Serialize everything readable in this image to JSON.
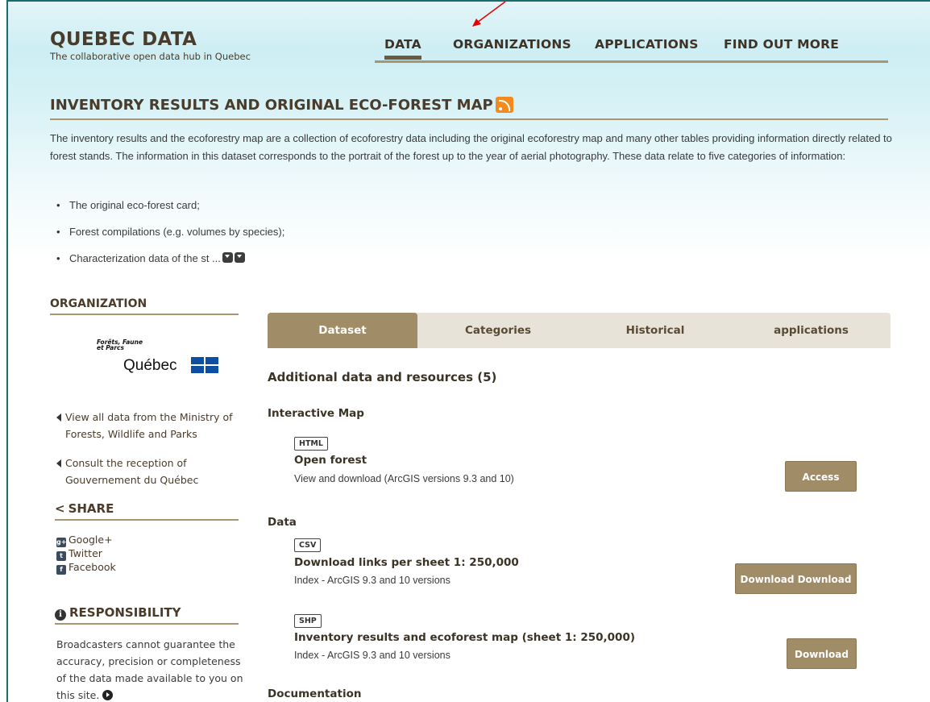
{
  "site": {
    "title": "QUEBEC DATA",
    "subtitle": "The collaborative open data hub in Quebec"
  },
  "nav": {
    "items": [
      {
        "label": "DATA",
        "active": true
      },
      {
        "label": "ORGANIZATIONS",
        "active": false
      },
      {
        "label": "APPLICATIONS",
        "active": false
      },
      {
        "label": "FIND OUT MORE",
        "active": false
      }
    ]
  },
  "dataset": {
    "title": "INVENTORY RESULTS AND ORIGINAL ECO-FOREST MAP",
    "description": "The inventory results and the ecoforestry map are a collection of ecoforestry data including the original ecoforestry map and many other tables providing information directly related to forest stands. The information in this dataset corresponds to the portrait of the forest up to the year of aerial photography. These data relate to five categories of information:",
    "bullets": [
      "The original eco-forest card;",
      "Forest compilations (e.g. volumes by species);",
      "Characterization data of the st ..."
    ]
  },
  "sidebar": {
    "organization_heading": "ORGANIZATION",
    "logo_line1": "Forêts, Faune",
    "logo_line2": "et Parcs",
    "logo_name": "Québec",
    "links": [
      "View all data from the Ministry of Forests, Wildlife and Parks",
      "Consult the reception of Gouvernement du Québec"
    ],
    "share_heading": "SHARE",
    "socials": [
      {
        "label": "Google+",
        "icon": "google-plus-icon",
        "glyph": "g+"
      },
      {
        "label": "Twitter",
        "icon": "twitter-icon",
        "glyph": "t"
      },
      {
        "label": "Facebook",
        "icon": "facebook-icon",
        "glyph": "f"
      }
    ],
    "responsibility_heading": "RESPONSIBILITY",
    "responsibility_text": "Broadcasters cannot guarantee the accuracy, precision or completeness of the data made available to you on this site."
  },
  "tabs": [
    "Dataset",
    "Categories",
    "Historical",
    "applications"
  ],
  "resources": {
    "title": "Additional data and resources (5)",
    "groups": [
      {
        "name": "Interactive Map"
      },
      {
        "name": "Data"
      },
      {
        "name": "Documentation"
      }
    ],
    "items": [
      {
        "format": "HTML",
        "title": "Open forest",
        "subtitle": "View and download (ArcGIS versions 9.3 and 10)",
        "button": "Access"
      },
      {
        "format": "CSV",
        "title": "Download links per sheet 1: 250,000",
        "subtitle": "Index - ArcGIS 9.3 and 10 versions",
        "button": "Download Download"
      },
      {
        "format": "SHP",
        "title": "Inventory results and ecoforest map (sheet 1: 250,000)",
        "subtitle": "Index - ArcGIS 9.3 and 10 versions",
        "button": "Download"
      }
    ]
  },
  "colors": {
    "accent": "#a08c66",
    "brand_text": "#4a3b2a",
    "annotation_arrow": "#e60000"
  }
}
